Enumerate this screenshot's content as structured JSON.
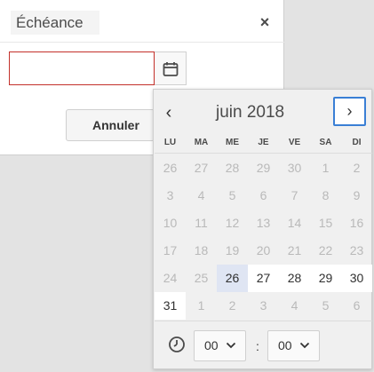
{
  "dialog": {
    "title": "Échéance",
    "close_glyph": "×",
    "date_value": "",
    "cancel_label": "Annuler"
  },
  "calendar": {
    "month_title": "juin 2018",
    "prev_glyph": "‹",
    "next_glyph": "›",
    "weekdays": [
      "LU",
      "MA",
      "ME",
      "JE",
      "VE",
      "SA",
      "DI"
    ],
    "weeks": [
      [
        {
          "d": "26",
          "c": false
        },
        {
          "d": "27",
          "c": false
        },
        {
          "d": "28",
          "c": false
        },
        {
          "d": "29",
          "c": false
        },
        {
          "d": "30",
          "c": false
        },
        {
          "d": "1",
          "c": false
        },
        {
          "d": "2",
          "c": false
        }
      ],
      [
        {
          "d": "3",
          "c": false
        },
        {
          "d": "4",
          "c": false
        },
        {
          "d": "5",
          "c": false
        },
        {
          "d": "6",
          "c": false
        },
        {
          "d": "7",
          "c": false
        },
        {
          "d": "8",
          "c": false
        },
        {
          "d": "9",
          "c": false
        }
      ],
      [
        {
          "d": "10",
          "c": false
        },
        {
          "d": "11",
          "c": false
        },
        {
          "d": "12",
          "c": false
        },
        {
          "d": "13",
          "c": false
        },
        {
          "d": "14",
          "c": false
        },
        {
          "d": "15",
          "c": false
        },
        {
          "d": "16",
          "c": false
        }
      ],
      [
        {
          "d": "17",
          "c": false
        },
        {
          "d": "18",
          "c": false
        },
        {
          "d": "19",
          "c": false
        },
        {
          "d": "20",
          "c": false
        },
        {
          "d": "21",
          "c": false
        },
        {
          "d": "22",
          "c": false
        },
        {
          "d": "23",
          "c": false
        }
      ],
      [
        {
          "d": "24",
          "c": false
        },
        {
          "d": "25",
          "c": false
        },
        {
          "d": "26",
          "c": true,
          "sel": true
        },
        {
          "d": "27",
          "c": true
        },
        {
          "d": "28",
          "c": true
        },
        {
          "d": "29",
          "c": true
        },
        {
          "d": "30",
          "c": true
        }
      ],
      [
        {
          "d": "31",
          "c": true
        },
        {
          "d": "1",
          "c": false
        },
        {
          "d": "2",
          "c": false
        },
        {
          "d": "3",
          "c": false
        },
        {
          "d": "4",
          "c": false
        },
        {
          "d": "5",
          "c": false
        },
        {
          "d": "6",
          "c": false
        }
      ]
    ],
    "hour": "00",
    "minute": "00",
    "time_separator": ":"
  },
  "icons": {
    "calendar": "calendar-icon",
    "clock": "clock-icon",
    "chevron": "chevron-down-icon"
  },
  "colors": {
    "error_border": "#c3302a",
    "focus_ring": "#3a7fd5",
    "selected_day": "#dfe5f3"
  }
}
